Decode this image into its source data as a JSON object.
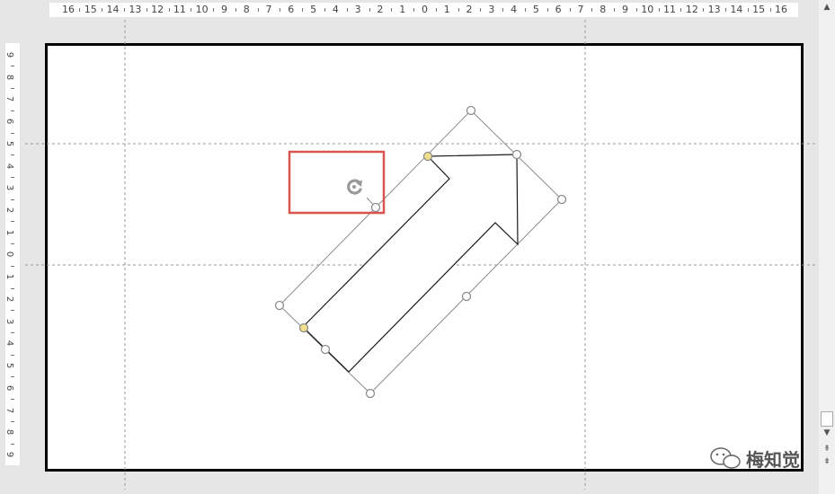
{
  "ruler": {
    "horizontal_labels": [
      "16",
      "15",
      "14",
      "13",
      "12",
      "11",
      "10",
      "9",
      "8",
      "7",
      "6",
      "5",
      "4",
      "3",
      "2",
      "1",
      "0",
      "1",
      "2",
      "3",
      "4",
      "5",
      "6",
      "7",
      "8",
      "9",
      "10",
      "11",
      "12",
      "13",
      "14",
      "15",
      "16"
    ],
    "vertical_labels": [
      "9",
      "8",
      "7",
      "6",
      "5",
      "4",
      "3",
      "2",
      "1",
      "0",
      "1",
      "2",
      "3",
      "4",
      "5",
      "6",
      "7",
      "8",
      "9"
    ]
  },
  "watermark": {
    "text": "梅知觉",
    "icon": "wechat-icon"
  },
  "colors": {
    "slide_border": "#000000",
    "guide_line": "#9a9a9a",
    "selection_box": "#8c8c8c",
    "handle_fill": "#ffffff",
    "adjust_handle_fill": "#f2df8e",
    "highlight_box": "#d9534f",
    "arrow_stroke": "#1a1a1a"
  }
}
